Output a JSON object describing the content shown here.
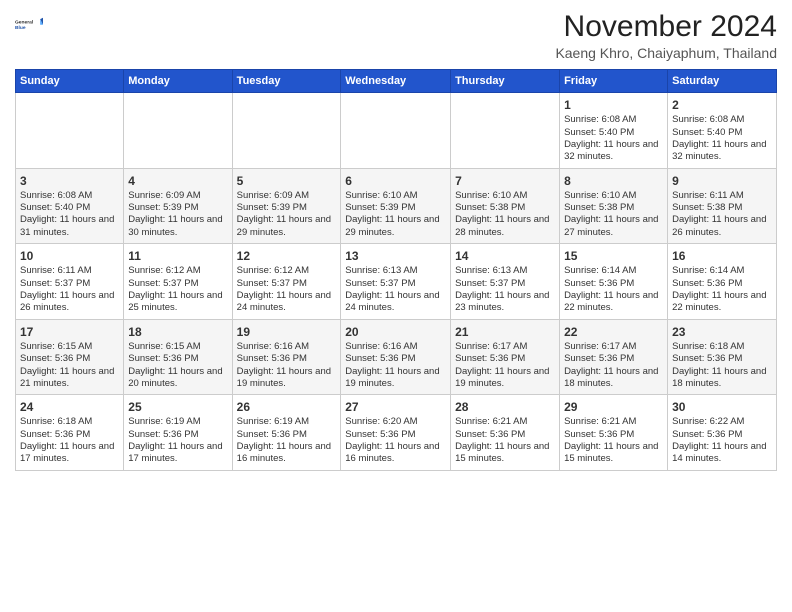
{
  "logo": {
    "line1": "General",
    "line2": "Blue"
  },
  "title": "November 2024",
  "location": "Kaeng Khro, Chaiyaphum, Thailand",
  "weekdays": [
    "Sunday",
    "Monday",
    "Tuesday",
    "Wednesday",
    "Thursday",
    "Friday",
    "Saturday"
  ],
  "weeks": [
    [
      {
        "day": "",
        "info": ""
      },
      {
        "day": "",
        "info": ""
      },
      {
        "day": "",
        "info": ""
      },
      {
        "day": "",
        "info": ""
      },
      {
        "day": "",
        "info": ""
      },
      {
        "day": "1",
        "info": "Sunrise: 6:08 AM\nSunset: 5:40 PM\nDaylight: 11 hours and 32 minutes."
      },
      {
        "day": "2",
        "info": "Sunrise: 6:08 AM\nSunset: 5:40 PM\nDaylight: 11 hours and 32 minutes."
      }
    ],
    [
      {
        "day": "3",
        "info": "Sunrise: 6:08 AM\nSunset: 5:40 PM\nDaylight: 11 hours and 31 minutes."
      },
      {
        "day": "4",
        "info": "Sunrise: 6:09 AM\nSunset: 5:39 PM\nDaylight: 11 hours and 30 minutes."
      },
      {
        "day": "5",
        "info": "Sunrise: 6:09 AM\nSunset: 5:39 PM\nDaylight: 11 hours and 29 minutes."
      },
      {
        "day": "6",
        "info": "Sunrise: 6:10 AM\nSunset: 5:39 PM\nDaylight: 11 hours and 29 minutes."
      },
      {
        "day": "7",
        "info": "Sunrise: 6:10 AM\nSunset: 5:38 PM\nDaylight: 11 hours and 28 minutes."
      },
      {
        "day": "8",
        "info": "Sunrise: 6:10 AM\nSunset: 5:38 PM\nDaylight: 11 hours and 27 minutes."
      },
      {
        "day": "9",
        "info": "Sunrise: 6:11 AM\nSunset: 5:38 PM\nDaylight: 11 hours and 26 minutes."
      }
    ],
    [
      {
        "day": "10",
        "info": "Sunrise: 6:11 AM\nSunset: 5:37 PM\nDaylight: 11 hours and 26 minutes."
      },
      {
        "day": "11",
        "info": "Sunrise: 6:12 AM\nSunset: 5:37 PM\nDaylight: 11 hours and 25 minutes."
      },
      {
        "day": "12",
        "info": "Sunrise: 6:12 AM\nSunset: 5:37 PM\nDaylight: 11 hours and 24 minutes."
      },
      {
        "day": "13",
        "info": "Sunrise: 6:13 AM\nSunset: 5:37 PM\nDaylight: 11 hours and 24 minutes."
      },
      {
        "day": "14",
        "info": "Sunrise: 6:13 AM\nSunset: 5:37 PM\nDaylight: 11 hours and 23 minutes."
      },
      {
        "day": "15",
        "info": "Sunrise: 6:14 AM\nSunset: 5:36 PM\nDaylight: 11 hours and 22 minutes."
      },
      {
        "day": "16",
        "info": "Sunrise: 6:14 AM\nSunset: 5:36 PM\nDaylight: 11 hours and 22 minutes."
      }
    ],
    [
      {
        "day": "17",
        "info": "Sunrise: 6:15 AM\nSunset: 5:36 PM\nDaylight: 11 hours and 21 minutes."
      },
      {
        "day": "18",
        "info": "Sunrise: 6:15 AM\nSunset: 5:36 PM\nDaylight: 11 hours and 20 minutes."
      },
      {
        "day": "19",
        "info": "Sunrise: 6:16 AM\nSunset: 5:36 PM\nDaylight: 11 hours and 19 minutes."
      },
      {
        "day": "20",
        "info": "Sunrise: 6:16 AM\nSunset: 5:36 PM\nDaylight: 11 hours and 19 minutes."
      },
      {
        "day": "21",
        "info": "Sunrise: 6:17 AM\nSunset: 5:36 PM\nDaylight: 11 hours and 19 minutes."
      },
      {
        "day": "22",
        "info": "Sunrise: 6:17 AM\nSunset: 5:36 PM\nDaylight: 11 hours and 18 minutes."
      },
      {
        "day": "23",
        "info": "Sunrise: 6:18 AM\nSunset: 5:36 PM\nDaylight: 11 hours and 18 minutes."
      }
    ],
    [
      {
        "day": "24",
        "info": "Sunrise: 6:18 AM\nSunset: 5:36 PM\nDaylight: 11 hours and 17 minutes."
      },
      {
        "day": "25",
        "info": "Sunrise: 6:19 AM\nSunset: 5:36 PM\nDaylight: 11 hours and 17 minutes."
      },
      {
        "day": "26",
        "info": "Sunrise: 6:19 AM\nSunset: 5:36 PM\nDaylight: 11 hours and 16 minutes."
      },
      {
        "day": "27",
        "info": "Sunrise: 6:20 AM\nSunset: 5:36 PM\nDaylight: 11 hours and 16 minutes."
      },
      {
        "day": "28",
        "info": "Sunrise: 6:21 AM\nSunset: 5:36 PM\nDaylight: 11 hours and 15 minutes."
      },
      {
        "day": "29",
        "info": "Sunrise: 6:21 AM\nSunset: 5:36 PM\nDaylight: 11 hours and 15 minutes."
      },
      {
        "day": "30",
        "info": "Sunrise: 6:22 AM\nSunset: 5:36 PM\nDaylight: 11 hours and 14 minutes."
      }
    ]
  ]
}
